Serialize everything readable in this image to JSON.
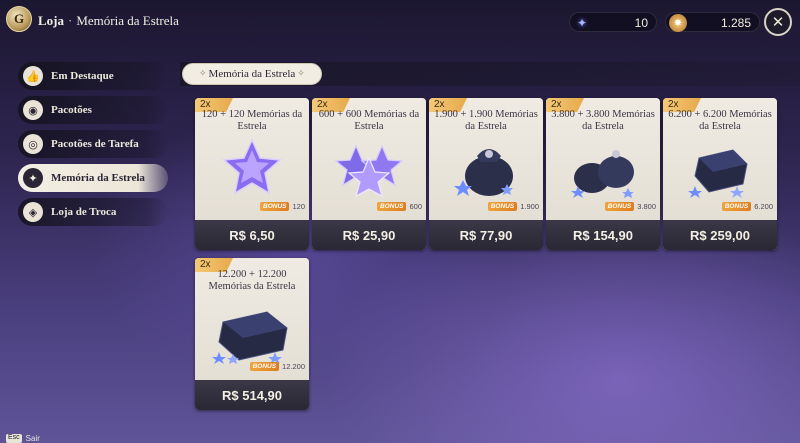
{
  "header": {
    "title": "Loja",
    "separator": "·",
    "subtitle": "Memória da Estrela",
    "logo_letter": "G",
    "currencies": [
      {
        "icon": "star-memory-icon",
        "value": "10"
      },
      {
        "icon": "stellar-jade-icon",
        "value": "1.285"
      }
    ],
    "close_label": "✕"
  },
  "sidebar": {
    "items": [
      {
        "label": "Em Destaque",
        "icon": "thumbs-up-icon",
        "glyph": "👍",
        "active": false
      },
      {
        "label": "Pacotões",
        "icon": "bag-icon",
        "glyph": "◉",
        "active": false
      },
      {
        "label": "Pacotões de Tarefa",
        "icon": "task-bag-icon",
        "glyph": "◎",
        "active": false
      },
      {
        "label": "Memória da Estrela",
        "icon": "star-bag-icon",
        "glyph": "✦",
        "active": true
      },
      {
        "label": "Loja de Troca",
        "icon": "exchange-icon",
        "glyph": "◈",
        "active": false
      }
    ]
  },
  "tabs": {
    "active_label": "Memória da Estrela",
    "left_ornament": "✧",
    "right_ornament": "✧"
  },
  "products": [
    {
      "multiplier": "2x",
      "name": "120 + 120 Memórias da Estrela",
      "bonus_tag": "BONUS",
      "bonus_value": "120",
      "price": "R$ 6,50",
      "icon": "single-star-icon"
    },
    {
      "multiplier": "2x",
      "name": "600 + 600 Memórias da Estrela",
      "bonus_tag": "BONUS",
      "bonus_value": "600",
      "price": "R$ 25,90",
      "icon": "star-cluster-icon"
    },
    {
      "multiplier": "2x",
      "name": "1.900 + 1.900 Memórias da Estrela",
      "bonus_tag": "BONUS",
      "bonus_value": "1.900",
      "price": "R$ 77,90",
      "icon": "star-pouch-icon"
    },
    {
      "multiplier": "2x",
      "name": "3.800 + 3.800 Memórias da Estrela",
      "bonus_tag": "BONUS",
      "bonus_value": "3.800",
      "price": "R$ 154,90",
      "icon": "star-pouches-icon"
    },
    {
      "multiplier": "2x",
      "name": "6.200 + 6.200 Memórias da Estrela",
      "bonus_tag": "BONUS",
      "bonus_value": "6.200",
      "price": "R$ 259,00",
      "icon": "star-chest-icon"
    },
    {
      "multiplier": "2x",
      "name": "12.200 + 12.200 Memórias da Estrela",
      "bonus_tag": "BONUS",
      "bonus_value": "12.200",
      "price": "R$ 514,90",
      "icon": "large-star-chest-icon"
    }
  ],
  "footer": {
    "exit_key": "Esc",
    "exit_label": "Sair"
  },
  "colors": {
    "accent_gold": "#e6a94a",
    "bonus_orange": "#dd7d22",
    "card_bg": "#ebe7de",
    "price_bar": "#2a2834"
  }
}
